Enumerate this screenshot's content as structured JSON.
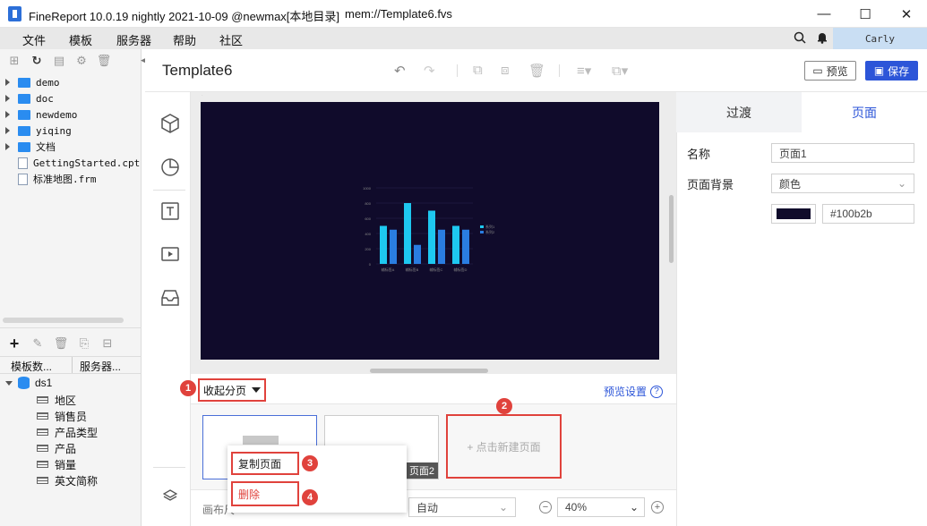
{
  "window": {
    "title": "FineReport 10.0.19 nightly 2021-10-09 @newmax[本地目录]",
    "path": "mem://Template6.fvs",
    "minimize": "—",
    "maximize": "☐",
    "close": "✕"
  },
  "menu": [
    "文件",
    "模板",
    "服务器",
    "帮助",
    "社区"
  ],
  "user": "Carly",
  "tree": [
    {
      "label": "demo",
      "type": "folder"
    },
    {
      "label": "doc",
      "type": "folder"
    },
    {
      "label": "newdemo",
      "type": "folder"
    },
    {
      "label": "yiqing",
      "type": "folder"
    },
    {
      "label": "文档",
      "type": "folder"
    },
    {
      "label": "GettingStarted.cpt",
      "type": "file"
    },
    {
      "label": "标准地图.frm",
      "type": "file"
    }
  ],
  "bottom_tabs": [
    "模板数...",
    "服务器..."
  ],
  "dataset": {
    "name": "ds1",
    "fields": [
      "地区",
      "销售员",
      "产品类型",
      "产品",
      "销量",
      "英文简称"
    ]
  },
  "template_name": "Template6",
  "buttons": {
    "preview": "预览",
    "save": "保存"
  },
  "right_tabs": [
    "过渡",
    "页面"
  ],
  "props": {
    "name_label": "名称",
    "name_value": "页面1",
    "bg_label": "页面背景",
    "bg_value": "颜色",
    "color_hex": "#100b2b"
  },
  "pages": {
    "collapse": "收起分页",
    "preview_settings": "预览设置",
    "add_page": "+ 点击新建页面",
    "page2": "页面2"
  },
  "context_menu": {
    "copy": "复制页面",
    "delete": "删除"
  },
  "badges": [
    "1",
    "2",
    "3",
    "4"
  ],
  "bottom_bar": {
    "layout_label": "画布尺",
    "auto": "自动",
    "zoom": "40%"
  },
  "colors": {
    "accent": "#2c55d8",
    "canvas_bg": "#100b2b",
    "highlight": "#e0423c",
    "bar1": "#1ec8f0",
    "bar2": "#2a7de1"
  },
  "chart_data": {
    "type": "bar",
    "categories": [
      "辅标签A",
      "辅标签B",
      "辅标签C",
      "辅标签D"
    ],
    "series": [
      {
        "name": "系列1",
        "values": [
          500,
          800,
          700,
          500
        ]
      },
      {
        "name": "系列2",
        "values": [
          450,
          250,
          450,
          450
        ]
      }
    ],
    "ylim": [
      0,
      1000
    ],
    "yticks": [
      "0",
      "200",
      "400",
      "600",
      "800",
      "1000"
    ]
  }
}
